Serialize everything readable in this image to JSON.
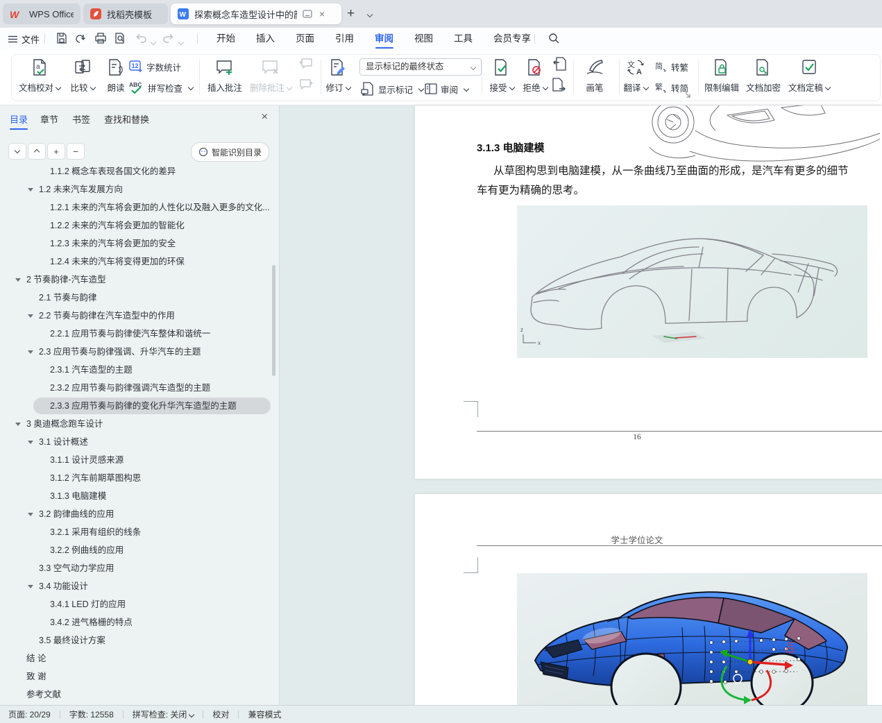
{
  "tab_bar": {
    "tabs": [
      {
        "label": "WPS Office",
        "icon": "wps-logo",
        "active": false
      },
      {
        "label": "找稻壳模板",
        "icon": "docer-logo",
        "active": false
      },
      {
        "label": "探索概念车造型设计中的韵律",
        "icon": "word-doc",
        "active": true
      }
    ],
    "new_tab_glyph": "+",
    "close_glyph": "×"
  },
  "menu_bar": {
    "file": "文件",
    "items": [
      "开始",
      "插入",
      "页面",
      "引用",
      "审阅",
      "视图",
      "工具",
      "会员专享"
    ],
    "active": "审阅",
    "quick_access_icons": [
      "save",
      "export-pdf",
      "print",
      "print-preview",
      "undo",
      "redo"
    ]
  },
  "ribbon": {
    "doc_proof": "文档校对",
    "compare": "比较",
    "read_aloud": "朗读",
    "word_count": "字数统计",
    "spell_check": "拼写检查",
    "insert_comment": "插入批注",
    "delete_comment": "删除批注",
    "track_changes": "修订",
    "markup_state": "显示标记的最终状态",
    "show_markup": "显示标记",
    "review_pane": "审阅",
    "accept": "接受",
    "reject": "拒绝",
    "brush": "画笔",
    "translate": "翻译",
    "to_traditional": "转繁",
    "to_simplified": "转简",
    "restrict_edit": "限制编辑",
    "encrypt": "文档加密",
    "finalize": "文档定稿",
    "badges": {
      "word_count_badge": "12",
      "spell_badge": "ABC",
      "proof_badge": "a",
      "simp_char": "简",
      "trad_char": "繁"
    }
  },
  "sidebar": {
    "tabs": [
      {
        "label": "目录",
        "active": true
      },
      {
        "label": "章节",
        "active": false
      },
      {
        "label": "书签",
        "active": false
      },
      {
        "label": "查找和替换",
        "active": false
      }
    ],
    "smart_toc": "智能识别目录",
    "toc": [
      {
        "t": "1.1.2 概念车表现各国文化的差异",
        "lv": 3,
        "arr": false,
        "sel": false
      },
      {
        "t": "1.2 未来汽车发展方向",
        "lv": 2,
        "arr": true,
        "sel": false
      },
      {
        "t": "1.2.1 未来的汽车将会更加的人性化以及融入更多的文化...",
        "lv": 3,
        "arr": false,
        "sel": false
      },
      {
        "t": "1.2.2 未来的汽车将会更加的智能化",
        "lv": 3,
        "arr": false,
        "sel": false
      },
      {
        "t": "1.2.3 未来的汽车将会更加的安全",
        "lv": 3,
        "arr": false,
        "sel": false
      },
      {
        "t": "1.2.4 未来的汽车将变得更加的环保",
        "lv": 3,
        "arr": false,
        "sel": false
      },
      {
        "t": "2 节奏韵律-汽车造型",
        "lv": 1,
        "arr": true,
        "sel": false
      },
      {
        "t": "2.1 节奏与韵律",
        "lv": 2,
        "arr": false,
        "sel": false
      },
      {
        "t": "2.2 节奏与韵律在汽车造型中的作用",
        "lv": 2,
        "arr": true,
        "sel": false
      },
      {
        "t": "2.2.1 应用节奏与韵律使汽车整体和谐统一",
        "lv": 3,
        "arr": false,
        "sel": false
      },
      {
        "t": "2.3 应用节奏与韵律强调、升华汽车的主题",
        "lv": 2,
        "arr": true,
        "sel": false
      },
      {
        "t": "2.3.1 汽车造型的主题",
        "lv": 3,
        "arr": false,
        "sel": false
      },
      {
        "t": "2.3.2 应用节奏与韵律强调汽车造型的主题",
        "lv": 3,
        "arr": false,
        "sel": false
      },
      {
        "t": "2.3.3 应用节奏与韵律的变化升华汽车造型的主题",
        "lv": 3,
        "arr": false,
        "sel": true
      },
      {
        "t": "3 奥迪概念跑车设计",
        "lv": 1,
        "arr": true,
        "sel": false
      },
      {
        "t": "3.1 设计概述",
        "lv": 2,
        "arr": true,
        "sel": false
      },
      {
        "t": "3.1.1 设计灵感来源",
        "lv": 3,
        "arr": false,
        "sel": false
      },
      {
        "t": "3.1.2 汽车前期草图构思",
        "lv": 3,
        "arr": false,
        "sel": false
      },
      {
        "t": "3.1.3 电脑建模",
        "lv": 3,
        "arr": false,
        "sel": false
      },
      {
        "t": "3.2 韵律曲线的应用",
        "lv": 2,
        "arr": true,
        "sel": false
      },
      {
        "t": "3.2.1 采用有组织的线条",
        "lv": 3,
        "arr": false,
        "sel": false
      },
      {
        "t": "3.2.2 例曲线的应用",
        "lv": 3,
        "arr": false,
        "sel": false
      },
      {
        "t": "3.3 空气动力学应用",
        "lv": 2,
        "arr": false,
        "sel": false
      },
      {
        "t": "3.4 功能设计",
        "lv": 2,
        "arr": true,
        "sel": false
      },
      {
        "t": "3.4.1 LED 灯的应用",
        "lv": 3,
        "arr": false,
        "sel": false
      },
      {
        "t": "3.4.2 进气格栅的特点",
        "lv": 3,
        "arr": false,
        "sel": false
      },
      {
        "t": "3.5 最终设计方案",
        "lv": 2,
        "arr": false,
        "sel": false
      },
      {
        "t": "结 论",
        "lv": 1,
        "arr": false,
        "sel": false
      },
      {
        "t": "致 谢",
        "lv": 1,
        "arr": false,
        "sel": false
      },
      {
        "t": "参考文献",
        "lv": 1,
        "arr": false,
        "sel": false
      }
    ]
  },
  "document": {
    "page1": {
      "heading": "3.1.3 电脑建模",
      "para1": "从草图构思到电脑建模，从一条曲线乃至曲面的形成，是汽车有更多的细节",
      "para2": "车有更为精确的思考。",
      "page_number": "16",
      "axis_z": "z",
      "axis_x": "x"
    },
    "page2": {
      "header": "学士学位论文"
    },
    "images": [
      "car-wireframe-sketch",
      "car-3d-blue-model",
      "car-lineart-partial"
    ]
  },
  "status_bar": {
    "page": "页面: 20/29",
    "words": "字数: 12558",
    "spell": "拼写检查: 关闭",
    "proof": "校对",
    "compat": "兼容模式"
  },
  "colors": {
    "accent_blue": "#2f66f3",
    "accent_green": "#18a05c",
    "accent_red": "#e0344a",
    "panel_bg": "#edf2f3",
    "canvas_bg": "#e2ebeb"
  }
}
